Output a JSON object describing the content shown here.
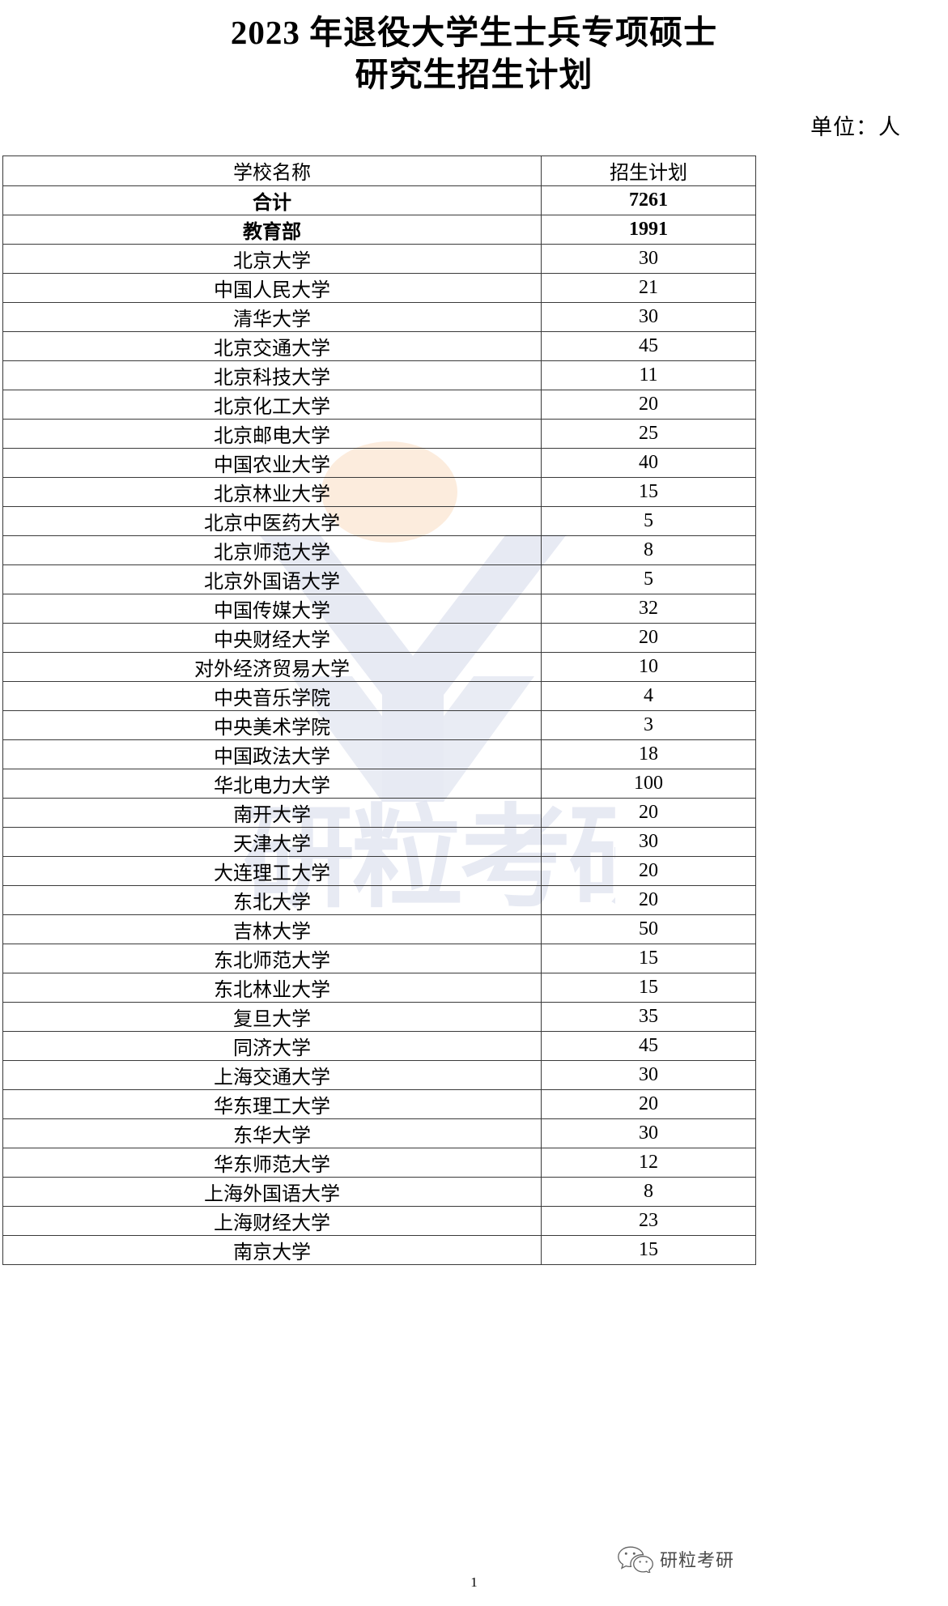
{
  "document": {
    "title_line1": "2023 年退役大学生士兵专项硕士",
    "title_line2": "研究生招生计划",
    "unit_note": "单位：人",
    "page_number": "1"
  },
  "watermark": {
    "brand_text": "研粒考研",
    "ellipse_color": "#fbe9d7",
    "logo_color": "#dfe3f0",
    "wechat_icon": "wechat-icon"
  },
  "table": {
    "columns": [
      "学校名称",
      "招生计划"
    ],
    "rows": [
      {
        "name": "合计",
        "plan": "7261",
        "emphasis": true
      },
      {
        "name": "教育部",
        "plan": "1991",
        "emphasis": true
      },
      {
        "name": "北京大学",
        "plan": "30",
        "emphasis": false
      },
      {
        "name": "中国人民大学",
        "plan": "21",
        "emphasis": false
      },
      {
        "name": "清华大学",
        "plan": "30",
        "emphasis": false
      },
      {
        "name": "北京交通大学",
        "plan": "45",
        "emphasis": false
      },
      {
        "name": "北京科技大学",
        "plan": "11",
        "emphasis": false
      },
      {
        "name": "北京化工大学",
        "plan": "20",
        "emphasis": false
      },
      {
        "name": "北京邮电大学",
        "plan": "25",
        "emphasis": false
      },
      {
        "name": "中国农业大学",
        "plan": "40",
        "emphasis": false
      },
      {
        "name": "北京林业大学",
        "plan": "15",
        "emphasis": false
      },
      {
        "name": "北京中医药大学",
        "plan": "5",
        "emphasis": false
      },
      {
        "name": "北京师范大学",
        "plan": "8",
        "emphasis": false
      },
      {
        "name": "北京外国语大学",
        "plan": "5",
        "emphasis": false
      },
      {
        "name": "中国传媒大学",
        "plan": "32",
        "emphasis": false
      },
      {
        "name": "中央财经大学",
        "plan": "20",
        "emphasis": false
      },
      {
        "name": "对外经济贸易大学",
        "plan": "10",
        "emphasis": false
      },
      {
        "name": "中央音乐学院",
        "plan": "4",
        "emphasis": false
      },
      {
        "name": "中央美术学院",
        "plan": "3",
        "emphasis": false
      },
      {
        "name": "中国政法大学",
        "plan": "18",
        "emphasis": false
      },
      {
        "name": "华北电力大学",
        "plan": "100",
        "emphasis": false
      },
      {
        "name": "南开大学",
        "plan": "20",
        "emphasis": false
      },
      {
        "name": "天津大学",
        "plan": "30",
        "emphasis": false
      },
      {
        "name": "大连理工大学",
        "plan": "20",
        "emphasis": false
      },
      {
        "name": "东北大学",
        "plan": "20",
        "emphasis": false
      },
      {
        "name": "吉林大学",
        "plan": "50",
        "emphasis": false
      },
      {
        "name": "东北师范大学",
        "plan": "15",
        "emphasis": false
      },
      {
        "name": "东北林业大学",
        "plan": "15",
        "emphasis": false
      },
      {
        "name": "复旦大学",
        "plan": "35",
        "emphasis": false
      },
      {
        "name": "同济大学",
        "plan": "45",
        "emphasis": false
      },
      {
        "name": "上海交通大学",
        "plan": "30",
        "emphasis": false
      },
      {
        "name": "华东理工大学",
        "plan": "20",
        "emphasis": false
      },
      {
        "name": "东华大学",
        "plan": "30",
        "emphasis": false
      },
      {
        "name": "华东师范大学",
        "plan": "12",
        "emphasis": false
      },
      {
        "name": "上海外国语大学",
        "plan": "8",
        "emphasis": false
      },
      {
        "name": "上海财经大学",
        "plan": "23",
        "emphasis": false
      },
      {
        "name": "南京大学",
        "plan": "15",
        "emphasis": false
      }
    ]
  }
}
